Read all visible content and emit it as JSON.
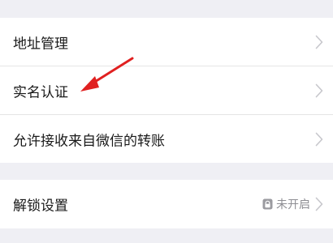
{
  "settings": {
    "items": [
      {
        "label": "地址管理"
      },
      {
        "label": "实名认证"
      },
      {
        "label": "允许接收来自微信的转账"
      }
    ],
    "lock": {
      "label": "解锁设置",
      "status": "未开启"
    }
  },
  "colors": {
    "annotation_arrow": "#e02020",
    "chevron": "#c7c7cc",
    "background": "#efeff4"
  }
}
